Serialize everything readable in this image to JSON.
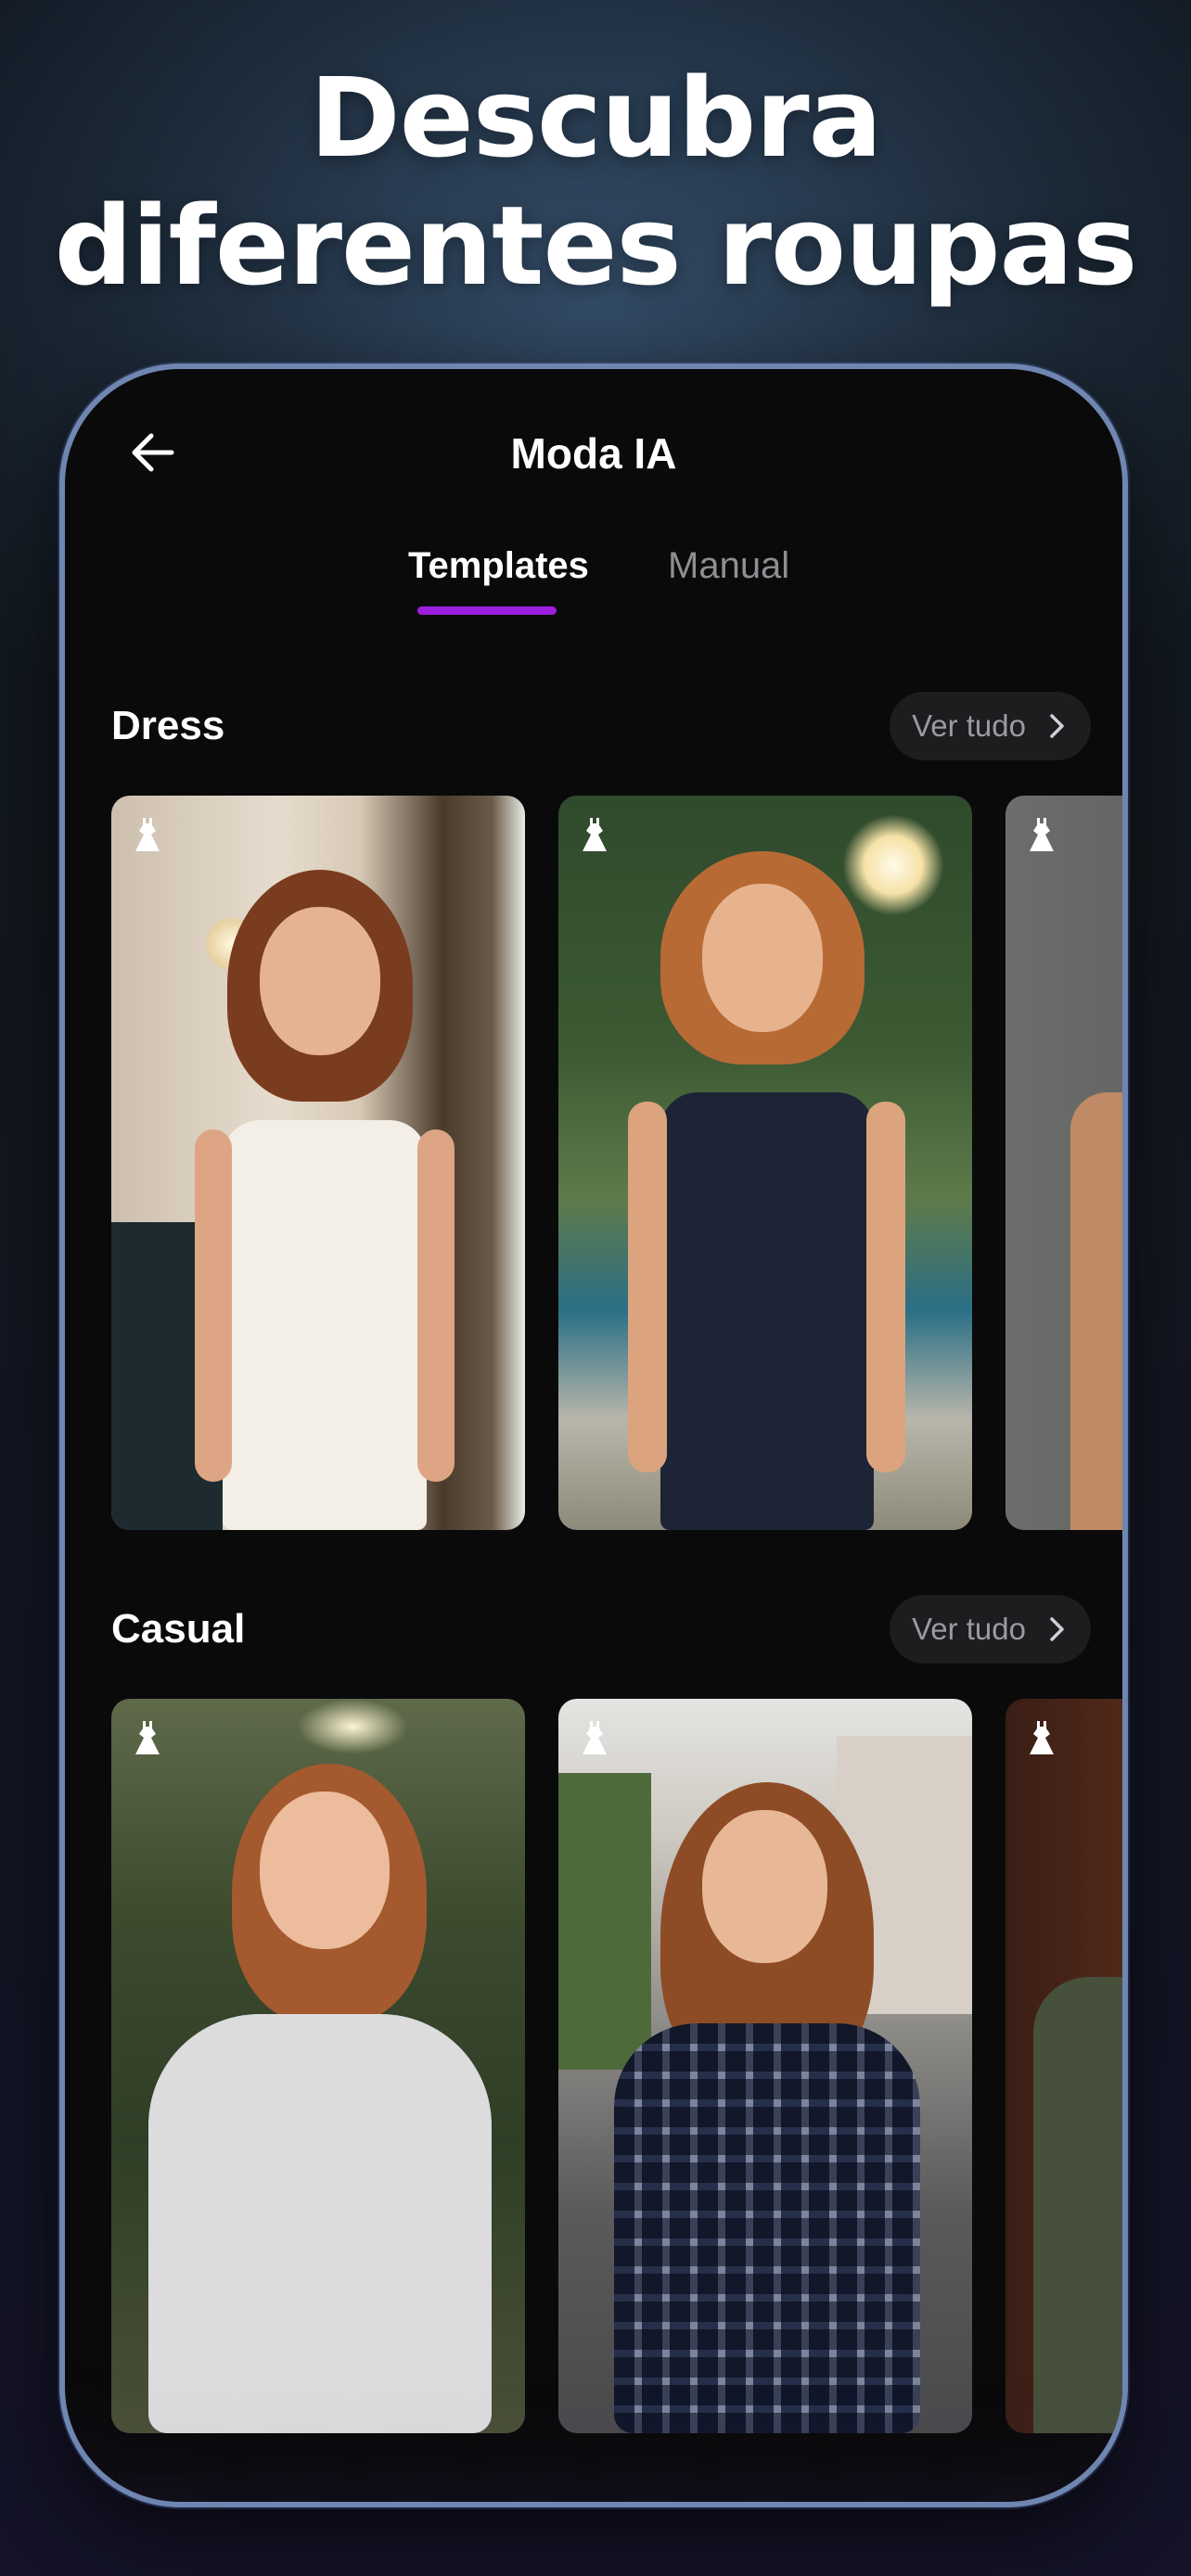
{
  "hero": {
    "line1": "Descubra",
    "line2": "diferentes roupas"
  },
  "screen": {
    "title": "Moda IA",
    "back_icon": "arrow-left-icon"
  },
  "tabs": [
    {
      "label": "Templates",
      "active": true
    },
    {
      "label": "Manual",
      "active": false
    }
  ],
  "sections": [
    {
      "title": "Dress",
      "see_all_label": "Ver tudo",
      "cards": [
        {
          "name": "white-dress",
          "badge_icon": "dress-icon"
        },
        {
          "name": "navy-dress",
          "badge_icon": "dress-icon"
        },
        {
          "name": "gray-dress",
          "badge_icon": "dress-icon"
        }
      ]
    },
    {
      "title": "Casual",
      "see_all_label": "Ver tudo",
      "cards": [
        {
          "name": "hoodie",
          "badge_icon": "dress-icon"
        },
        {
          "name": "plaid-shirt",
          "badge_icon": "dress-icon"
        },
        {
          "name": "jacket",
          "badge_icon": "dress-icon"
        }
      ]
    }
  ],
  "colors": {
    "accent": "#9d1ee0",
    "frame": "#6e86b0",
    "screen_bg": "#0a0a0b"
  }
}
